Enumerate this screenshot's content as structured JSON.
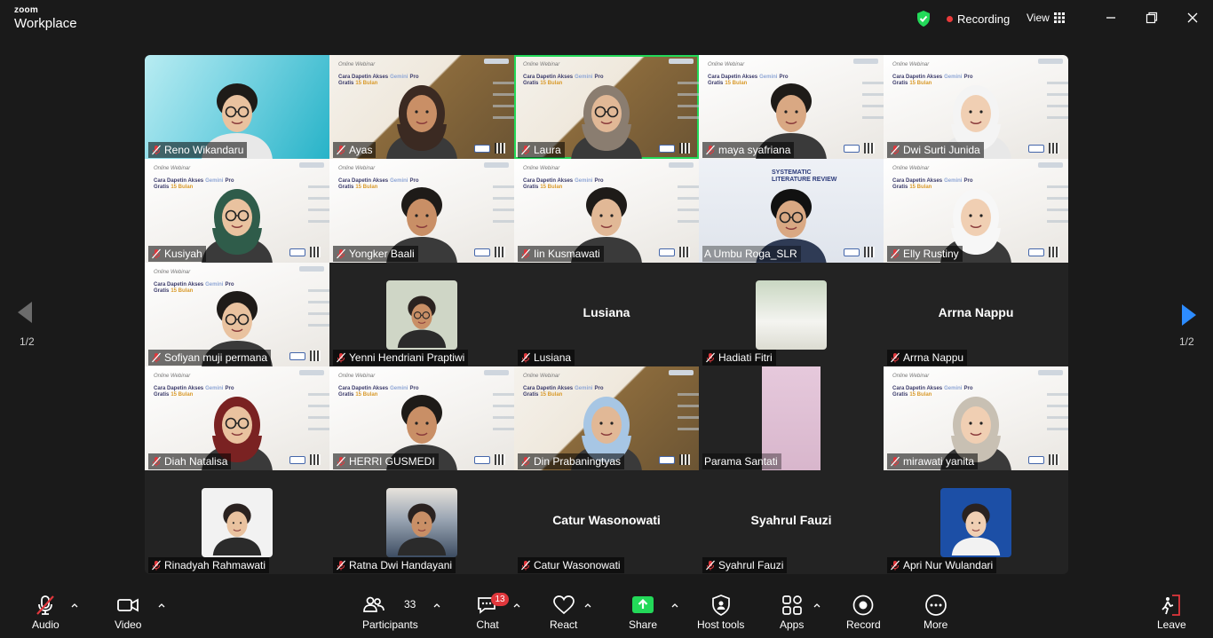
{
  "app": {
    "brand_top": "zoom",
    "brand_bottom": "Workplace"
  },
  "topbar": {
    "recording_label": "Recording",
    "view_label": "View"
  },
  "pager": {
    "left": "1/2",
    "right": "1/2"
  },
  "participants": [
    {
      "name": "Reno Wikandaru"
    },
    {
      "name": "Ayas"
    },
    {
      "name": "Laura"
    },
    {
      "name": "maya syafriana"
    },
    {
      "name": "Dwi Surti Junida"
    },
    {
      "name": "Kusiyah"
    },
    {
      "name": "Yongker Baali"
    },
    {
      "name": "Iin Kusmawati"
    },
    {
      "name": "A Umbu Roga_SLR"
    },
    {
      "name": "Elly Rustiny"
    },
    {
      "name": "Sofiyan muji permana"
    },
    {
      "name": "Yenni Hendriani Praptiwi"
    },
    {
      "name": "Lusiana",
      "big": "Lusiana"
    },
    {
      "name": "Hadiati Fitri"
    },
    {
      "name": "Arrna Nappu",
      "big": "Arrna Nappu"
    },
    {
      "name": "Diah Natalisa"
    },
    {
      "name": "HERRI GUSMEDI"
    },
    {
      "name": "Din Prabaningtyas"
    },
    {
      "name": "Parama Santati"
    },
    {
      "name": "mirawati yanita"
    },
    {
      "name": "Rinadyah Rahmawati"
    },
    {
      "name": "Ratna Dwi Handayani"
    },
    {
      "name": "Catur Wasonowati",
      "big": "Catur Wasonowati"
    },
    {
      "name": "Syahrul Fauzi",
      "big": "Syahrul Fauzi"
    },
    {
      "name": "Apri Nur Wulandari"
    }
  ],
  "slide": {
    "line1": "Online Webinar",
    "line2": "Cara Dapetin Akses",
    "line2b": "Gemini",
    "line2c": "Pro",
    "line3": "Gratis",
    "line3b": "15 Bulan"
  },
  "slr_slide": {
    "line1": "SYSTEMATIC",
    "line2": "LITERATURE REVIEW"
  },
  "toolbar": {
    "audio": "Audio",
    "video": "Video",
    "participants": "Participants",
    "participants_count": "33",
    "chat": "Chat",
    "chat_badge": "13",
    "react": "React",
    "share": "Share",
    "host_tools": "Host tools",
    "apps": "Apps",
    "record": "Record",
    "more": "More",
    "leave": "Leave"
  },
  "colors": {
    "active_speaker": "#23d959",
    "recording": "#ea3a3a",
    "share": "#23d959",
    "pager_active": "#2d8cff",
    "badge": "#e0373c"
  }
}
